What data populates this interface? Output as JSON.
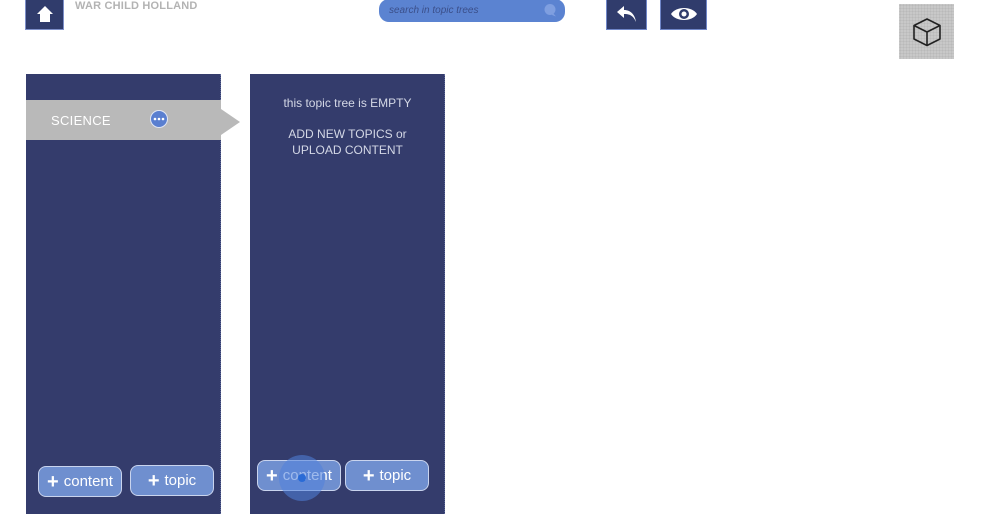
{
  "header": {
    "org_name": "WAR CHILD HOLLAND",
    "search": {
      "placeholder": "search in topic trees",
      "value": ""
    }
  },
  "columns": [
    {
      "topic": {
        "label": "SCIENCE"
      },
      "buttons": {
        "content_label": "content",
        "topic_label": "topic"
      }
    },
    {
      "empty_message_line1": "this topic tree is EMPTY",
      "empty_message_line2a": "ADD NEW TOPICS or",
      "empty_message_line2b": "UPLOAD CONTENT",
      "buttons": {
        "content_label": "content",
        "topic_label": "topic"
      }
    }
  ],
  "colors": {
    "column_bg": "#343c6c",
    "topic_highlight": "#b9b9b9",
    "button_blue": "#6f8fcf",
    "search_blue": "#5b83d1"
  }
}
